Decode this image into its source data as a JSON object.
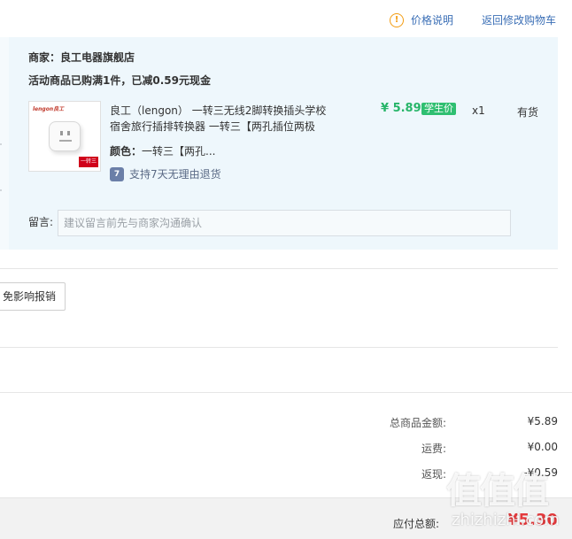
{
  "header": {
    "price_info_label": "价格说明",
    "back_link_label": "返回修改购物车"
  },
  "order": {
    "shop_label": "商家：良工电器旗舰店",
    "promo_text": "活动商品已购满1件，已减0.59元现金",
    "item": {
      "image_brand": "lengon良工",
      "image_tag": "一转三",
      "title_line1": "良工（lengon） 一转三无线2脚转换插头学校",
      "title_line2": "宿舍旅行插排转换器 一转三【两孔插位两极",
      "color_label": "颜色：",
      "color_value": "一转三【两孔...",
      "return_icon_text": "7",
      "return_policy": "支持7天无理由退货",
      "price": "¥ 5.89",
      "student_badge": "学生价",
      "quantity": "x1",
      "stock": "有货"
    },
    "message": {
      "label": "留言:",
      "placeholder": "建议留言前先与商家沟通确认"
    }
  },
  "actions": {
    "report_button": "免影响报销"
  },
  "summary": {
    "goods_total_label": "总商品金额:",
    "goods_total_value": "¥5.89",
    "shipping_label": "运费:",
    "shipping_value": "¥0.00",
    "cashback_label": "返现:",
    "cashback_value": "-¥0.59",
    "payable_label": "应付总额:",
    "payable_value": "¥5.30"
  },
  "watermark": {
    "logo": "值值值",
    "site": "zhizhizhi.com"
  },
  "colors": {
    "accent_link": "#3b6fb6",
    "price_green": "#27b569",
    "total_red": "#e4393c",
    "card_bg": "#eef7fc"
  }
}
